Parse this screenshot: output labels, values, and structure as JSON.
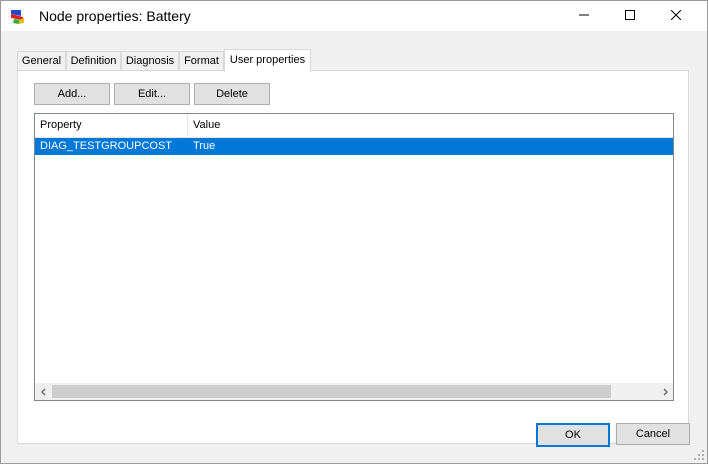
{
  "window": {
    "title": "Node properties: Battery",
    "controls": {
      "minimize": "minimize-icon",
      "maximize": "maximize-icon",
      "close": "close-icon"
    }
  },
  "tabs": [
    {
      "label": "General"
    },
    {
      "label": "Definition"
    },
    {
      "label": "Diagnosis"
    },
    {
      "label": "Format"
    },
    {
      "label": "User properties",
      "active": true
    }
  ],
  "toolbar": {
    "add_label": "Add...",
    "edit_label": "Edit...",
    "delete_label": "Delete"
  },
  "table": {
    "columns": [
      "Property",
      "Value"
    ],
    "rows": [
      {
        "property": "DIAG_TESTGROUPCOST",
        "value": "True",
        "selected": true
      }
    ]
  },
  "footer": {
    "ok_label": "OK",
    "cancel_label": "Cancel"
  },
  "colors": {
    "selection": "#0078d7",
    "default_button_border": "#0078d7",
    "panel_bg": "#f0f0f0"
  }
}
